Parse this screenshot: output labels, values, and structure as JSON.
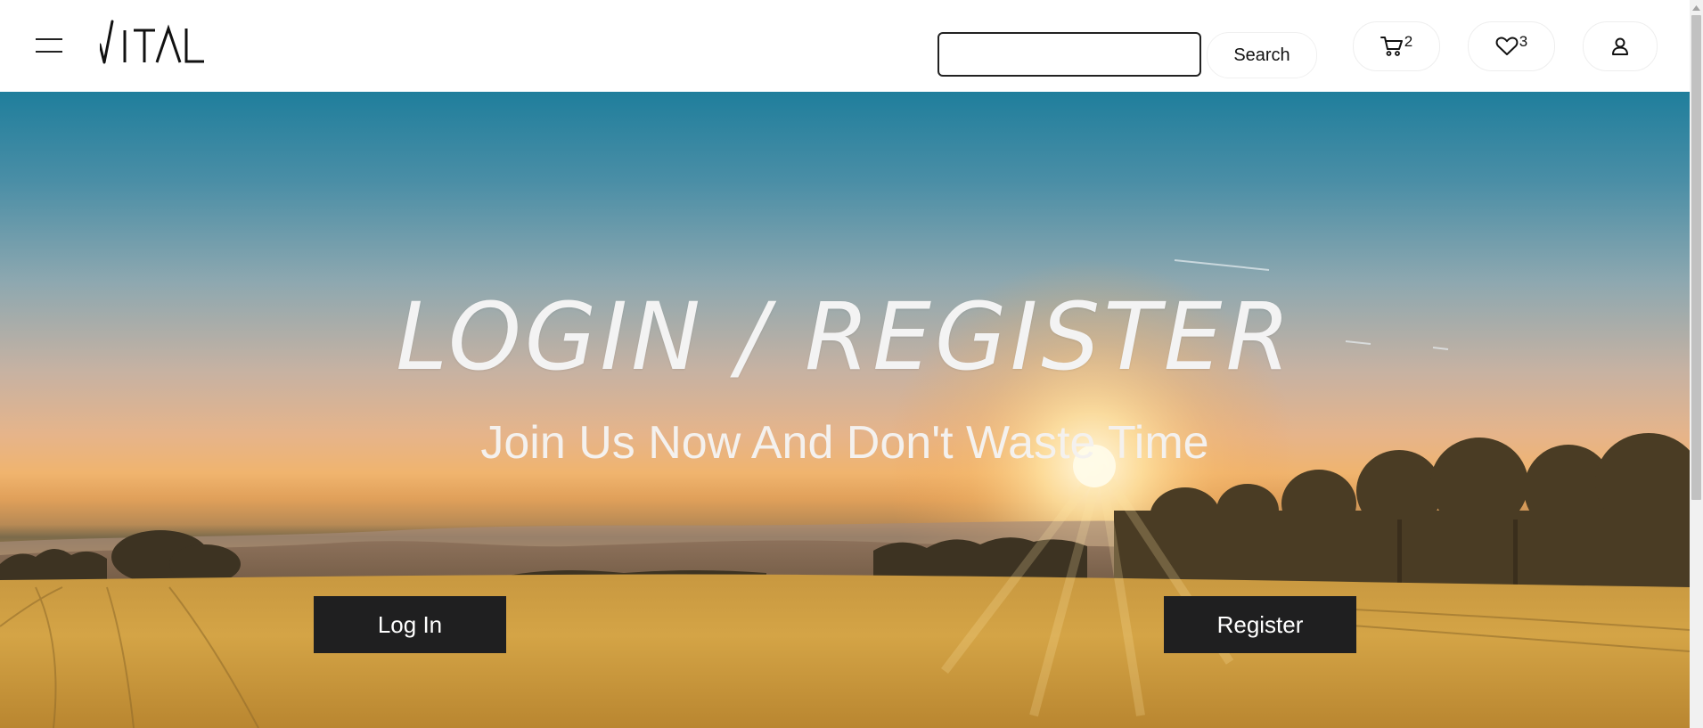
{
  "header": {
    "brand": "VITAL",
    "search": {
      "value": "",
      "placeholder": "",
      "button_label": "Search"
    },
    "cart": {
      "icon": "cart-icon",
      "count": "2"
    },
    "favorites": {
      "icon": "heart-icon",
      "count": "3"
    },
    "account": {
      "icon": "user-icon"
    },
    "menu": {
      "icon": "hamburger-menu-icon"
    }
  },
  "hero": {
    "title": "LOGIN / REGISTER",
    "subtitle": "Join Us Now And Don't Waste Time",
    "login_label": "Log In",
    "register_label": "Register"
  },
  "colors": {
    "button_bg": "#1f1f20",
    "button_text": "#ffffff",
    "hero_text": "#f3f3f3"
  }
}
